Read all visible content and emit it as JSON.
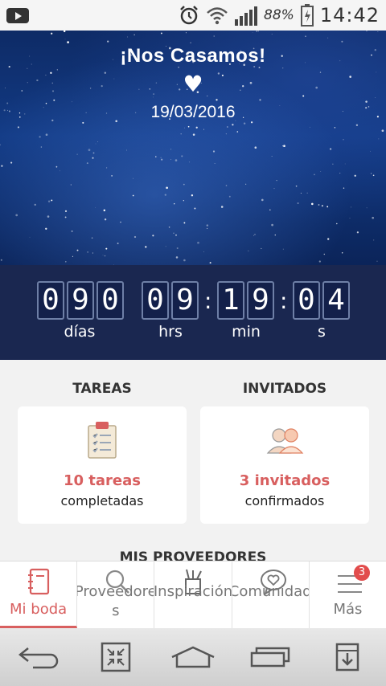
{
  "status_bar": {
    "battery_percent": "88%",
    "time": "14:42"
  },
  "hero": {
    "title": "¡Nos Casamos!",
    "heart": "♥",
    "date": "19/03/2016"
  },
  "countdown": {
    "days_digits": [
      "0",
      "9",
      "0"
    ],
    "hours_digits": [
      "0",
      "9"
    ],
    "minutes_digits": [
      "1",
      "9"
    ],
    "seconds_digits": [
      "0",
      "4"
    ],
    "separator": ":",
    "days_label": "días",
    "hours_label": "hrs",
    "minutes_label": "min",
    "seconds_label": "s"
  },
  "cards": {
    "tasks_heading": "TAREAS",
    "tasks_count": "10 tareas",
    "tasks_sub": "completadas",
    "guests_heading": "INVITADOS",
    "guests_count": "3 invitados",
    "guests_sub": "confirmados",
    "providers_heading": "MIS PROVEEDORES"
  },
  "tabs": [
    {
      "label": "Mi boda",
      "icon": "notebook-icon",
      "active": true
    },
    {
      "label": "Proveedores",
      "icon": "search-icon",
      "active": false
    },
    {
      "label": "Inspiración",
      "icon": "pencil-cup-icon",
      "active": false
    },
    {
      "label": "Comunidad",
      "icon": "chat-heart-icon",
      "active": false
    },
    {
      "label": "Más",
      "icon": "menu-icon",
      "active": false,
      "badge": "3"
    }
  ],
  "colors": {
    "accent": "#d85f5f",
    "countdown_bg": "#1a2750",
    "badge": "#e24c4c"
  }
}
